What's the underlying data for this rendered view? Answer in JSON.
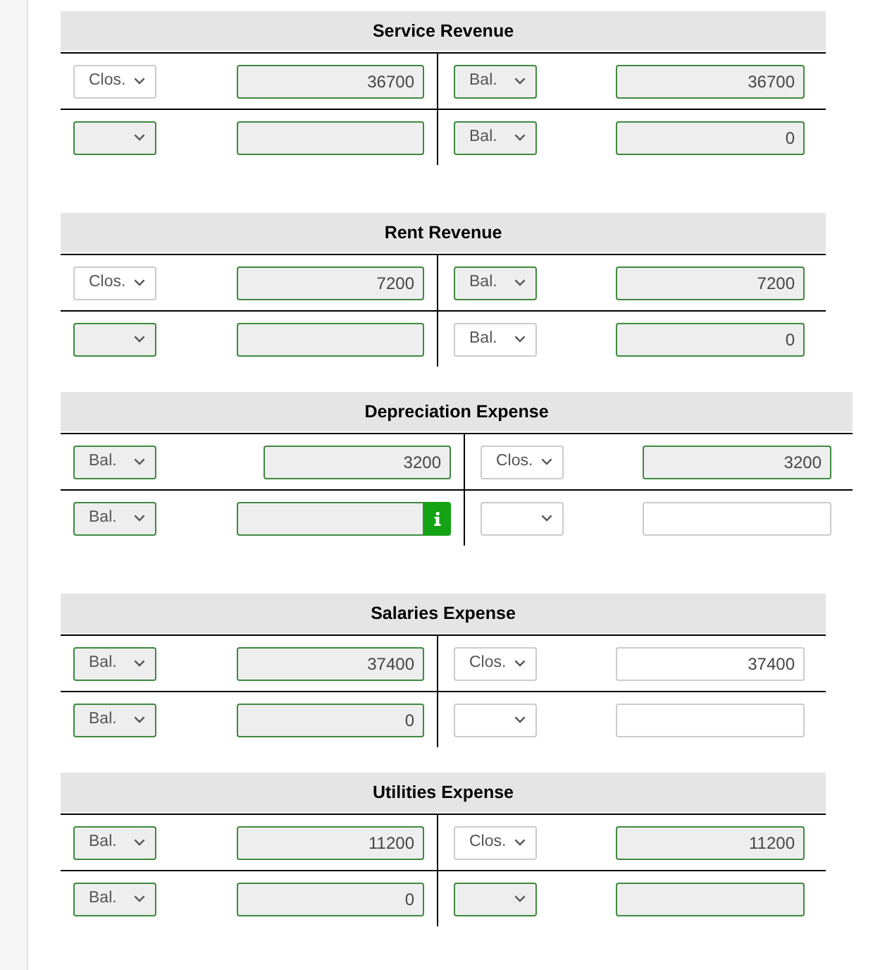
{
  "accounts": [
    {
      "title": "Service Revenue",
      "rows": [
        {
          "left": {
            "select": {
              "value": "Clos.",
              "correct": false
            },
            "amount": {
              "value": "36700",
              "correct": true
            }
          },
          "right": {
            "select": {
              "value": "Bal.",
              "correct": true
            },
            "amount": {
              "value": "36700",
              "correct": true
            }
          }
        },
        {
          "left": {
            "select": {
              "correct": true
            },
            "amount": {
              "correct": true
            }
          },
          "right": {
            "select": {
              "value": "Bal.",
              "correct": true
            },
            "amount": {
              "value": "0",
              "correct": true
            }
          }
        }
      ]
    },
    {
      "title": "Rent Revenue",
      "rows": [
        {
          "left": {
            "select": {
              "value": "Clos.",
              "correct": false
            },
            "amount": {
              "value": "7200",
              "correct": true
            }
          },
          "right": {
            "select": {
              "value": "Bal.",
              "correct": true
            },
            "amount": {
              "value": "7200",
              "correct": true
            }
          }
        },
        {
          "left": {
            "select": {
              "correct": true
            },
            "amount": {
              "correct": true
            }
          },
          "right": {
            "select": {
              "value": "Bal.",
              "correct": false
            },
            "amount": {
              "value": "0",
              "correct": true
            }
          }
        }
      ]
    },
    {
      "title": "Depreciation Expense",
      "rows": [
        {
          "left": {
            "select": {
              "value": "Bal.",
              "correct": true
            },
            "amount": {
              "value": "3200",
              "correct": true
            }
          },
          "right": {
            "select": {
              "value": "Clos.",
              "correct": false
            },
            "amount": {
              "value": "3200",
              "correct": true
            }
          }
        },
        {
          "left": {
            "select": {
              "value": "Bal.",
              "correct": true
            },
            "amount": {
              "correct": true,
              "info": true
            }
          },
          "right": {
            "select": {
              "correct": false
            },
            "amount": {
              "correct": false
            }
          }
        }
      ]
    },
    {
      "title": "Salaries Expense",
      "rows": [
        {
          "left": {
            "select": {
              "value": "Bal.",
              "correct": true
            },
            "amount": {
              "value": "37400",
              "correct": true
            }
          },
          "right": {
            "select": {
              "value": "Clos.",
              "correct": false
            },
            "amount": {
              "value": "37400",
              "correct": false
            }
          }
        },
        {
          "left": {
            "select": {
              "value": "Bal.",
              "correct": true
            },
            "amount": {
              "value": "0",
              "correct": true
            }
          },
          "right": {
            "select": {
              "correct": false
            },
            "amount": {
              "correct": false
            }
          }
        }
      ]
    },
    {
      "title": "Utilities Expense",
      "rows": [
        {
          "left": {
            "select": {
              "value": "Bal.",
              "correct": true
            },
            "amount": {
              "value": "11200",
              "correct": true
            }
          },
          "right": {
            "select": {
              "value": "Clos.",
              "correct": false
            },
            "amount": {
              "value": "11200",
              "correct": true
            }
          }
        },
        {
          "left": {
            "select": {
              "value": "Bal.",
              "correct": true
            },
            "amount": {
              "value": "0",
              "correct": true
            }
          },
          "right": {
            "select": {
              "correct": true
            },
            "amount": {
              "correct": true
            }
          }
        }
      ]
    }
  ]
}
